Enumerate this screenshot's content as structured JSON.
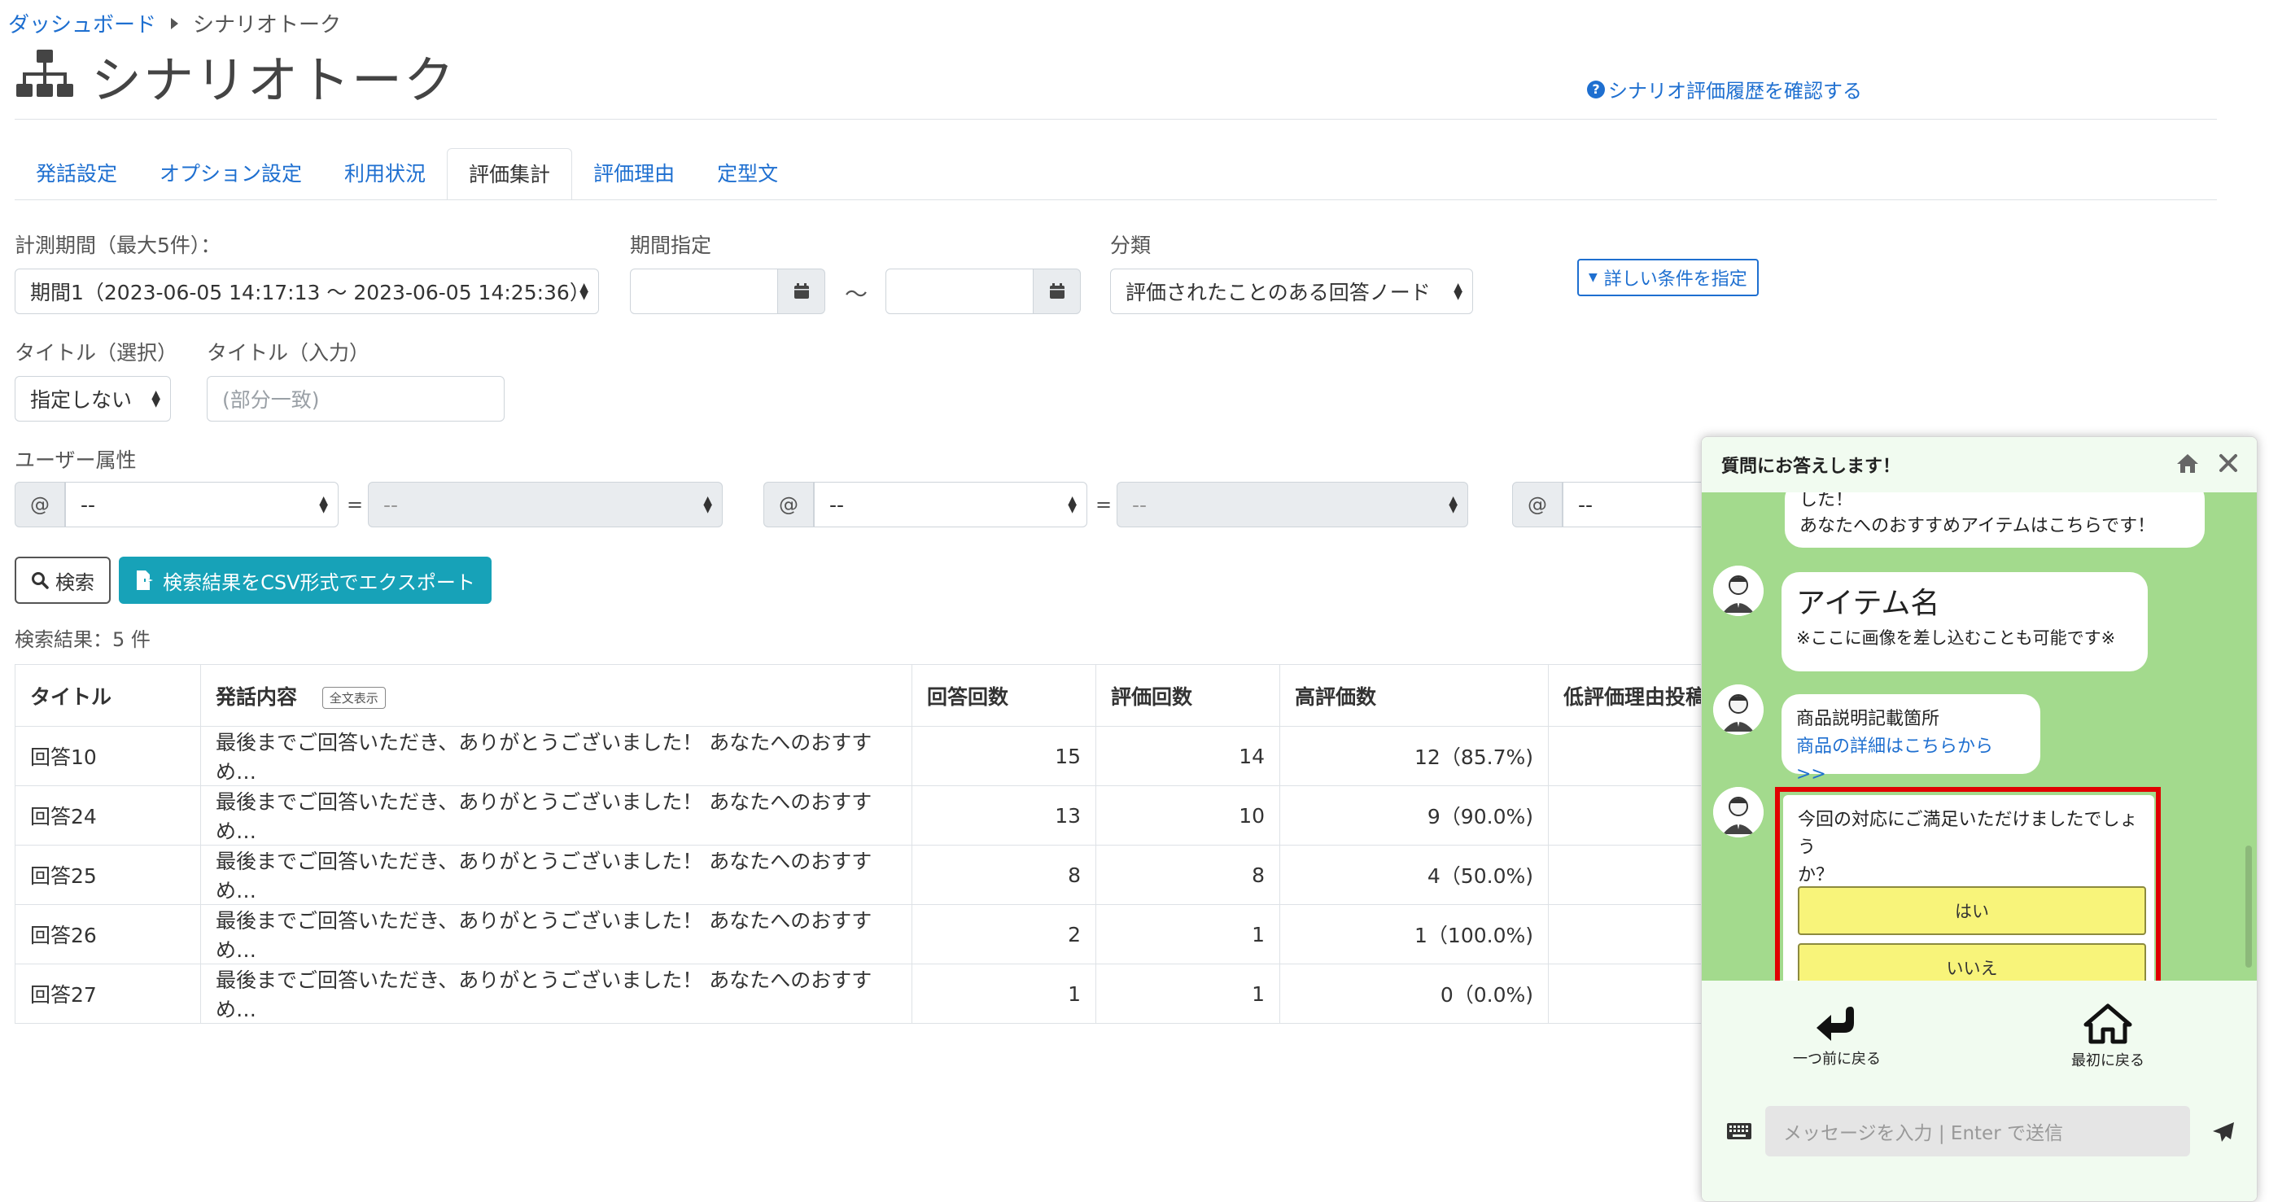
{
  "breadcrumb": {
    "home": "ダッシュボード",
    "current": "シナリオトーク"
  },
  "page": {
    "title": "シナリオトーク",
    "help_link": "シナリオ評価履歴を確認する"
  },
  "tabs": [
    "発話設定",
    "オプション設定",
    "利用状況",
    "評価集計",
    "評価理由",
    "定型文"
  ],
  "active_tab": "評価集計",
  "filters": {
    "period_label": "計測期間（最大5件）：",
    "period_value": "期間1（2023-06-05 14:17:13 ～ 2023-06-05 14:25:36）",
    "range_label": "期間指定",
    "range_sep": "～",
    "category_label": "分類",
    "category_value": "評価されたことのある回答ノード",
    "detail_button": "詳しい条件を指定",
    "title_select_label": "タイトル（選択）",
    "title_select_value": "指定しない",
    "title_input_label": "タイトル（入力）",
    "title_input_placeholder": "(部分一致)",
    "user_attr_label": "ユーザー属性",
    "attr_prefix": "@",
    "attr_value": "--",
    "eq": "="
  },
  "actions": {
    "search": "検索",
    "export": "検索結果をCSV形式でエクスポート"
  },
  "result_count": "検索結果：5 件",
  "table": {
    "headers": [
      "タイトル",
      "発話内容",
      "回答回数",
      "評価回数",
      "高評価数",
      "低評価理由投稿"
    ],
    "fulltext_badge": "全文表示",
    "rows": [
      [
        "回答10",
        "最後までご回答いただき、ありがとうございました！ あなたへのおすすめ…",
        "15",
        "14",
        "12（85.7%)"
      ],
      [
        "回答24",
        "最後までご回答いただき、ありがとうございました！ あなたへのおすすめ…",
        "13",
        "10",
        "9（90.0%)"
      ],
      [
        "回答25",
        "最後までご回答いただき、ありがとうございました！ あなたへのおすすめ…",
        "8",
        "8",
        "4（50.0%)"
      ],
      [
        "回答26",
        "最後までご回答いただき、ありがとうございました！ あなたへのおすすめ…",
        "2",
        "1",
        "1（100.0%)"
      ],
      [
        "回答27",
        "最後までご回答いただき、ありがとうございました！ あなたへのおすすめ…",
        "1",
        "1",
        "0（0.0%)"
      ]
    ]
  },
  "chat": {
    "header_title": "質問にお答えします！",
    "msg1_line1": "した！",
    "msg1_line2": "あなたへのおすすめアイテムはこちらです！",
    "msg2_title": "アイテム名",
    "msg2_note": "※ここに画像を差し込むことも可能です※",
    "msg3_line1": "商品説明記載箇所",
    "msg3_link": "商品の詳細はこちらから >>",
    "question_line1": "今回の対応にご満足いただけましたでしょう",
    "question_line2": "か？",
    "yes": "はい",
    "no": "いいえ",
    "back": "一つ前に戻る",
    "home": "最初に戻る",
    "input_placeholder": "メッセージを入力 | Enter で送信",
    "accent_bg": "#a3da8d",
    "highlight_color": "#e00000"
  }
}
